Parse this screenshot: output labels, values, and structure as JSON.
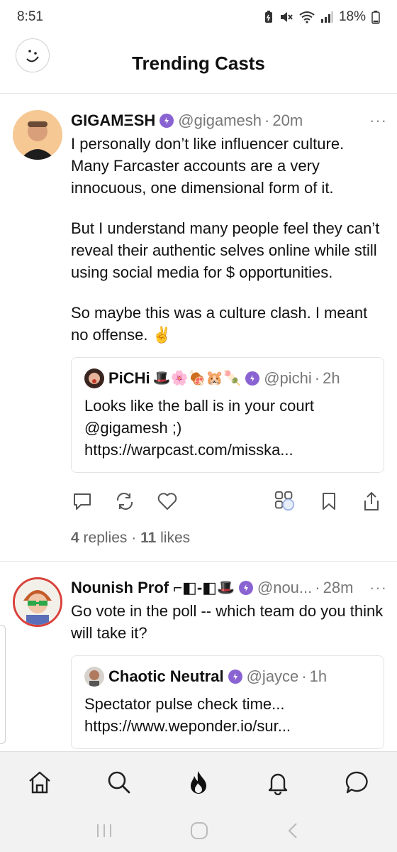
{
  "status_bar": {
    "time": "8:51",
    "battery": "18%",
    "icons": [
      "battery-saver-icon",
      "mute-icon",
      "wifi-icon",
      "signal-icon"
    ]
  },
  "header": {
    "title": "Trending Casts",
    "avatar_icon": "smiley-face-icon"
  },
  "casts": [
    {
      "display_name": "GIGAMΞSH",
      "handle": "@gigamesh",
      "separator": "·",
      "time": "20m",
      "more": "···",
      "paragraphs": [
        "I personally don’t like influencer culture. Many Farcaster accounts are a very innocuous, one dimensional form of it.",
        "But I understand many people feel they can’t reveal their authentic selves online while still using social media for $ opportunities.",
        "So maybe this was a culture clash. I meant no offense. ✌️"
      ],
      "embed": {
        "display_name": "PiCHi",
        "name_emojis": "🎩🌸🍖🐹🍡",
        "handle": "@pichi",
        "separator": "·",
        "time": "2h",
        "text": "Looks like the ball is in your court @gigamesh  ;) https://warpcast.com/misska..."
      },
      "replies_count": "4",
      "replies_label": "replies",
      "meta_separator": "·",
      "likes_count": "11",
      "likes_label": "likes"
    },
    {
      "display_name": "Nounish Prof ⌐◧-◧",
      "name_emojis": "🎩",
      "handle": "@nou...",
      "separator": "·",
      "time": "28m",
      "more": "···",
      "paragraphs": [
        "Go vote in the poll -- which team do you think will take it?"
      ],
      "embed": {
        "display_name": "Chaotic Neutral",
        "handle": "@jayce",
        "separator": "·",
        "time": "1h",
        "text": "Spectator pulse check time... https://www.weponder.io/sur..."
      }
    }
  ],
  "bottom_nav": [
    {
      "icon": "home-icon"
    },
    {
      "icon": "search-icon"
    },
    {
      "icon": "trending-flame-icon"
    },
    {
      "icon": "bell-icon"
    },
    {
      "icon": "chat-bubble-icon"
    }
  ],
  "colors": {
    "verified": "#8a63d2",
    "text": "#111111",
    "muted": "#777777",
    "nav_bg": "#f2f2f2"
  }
}
